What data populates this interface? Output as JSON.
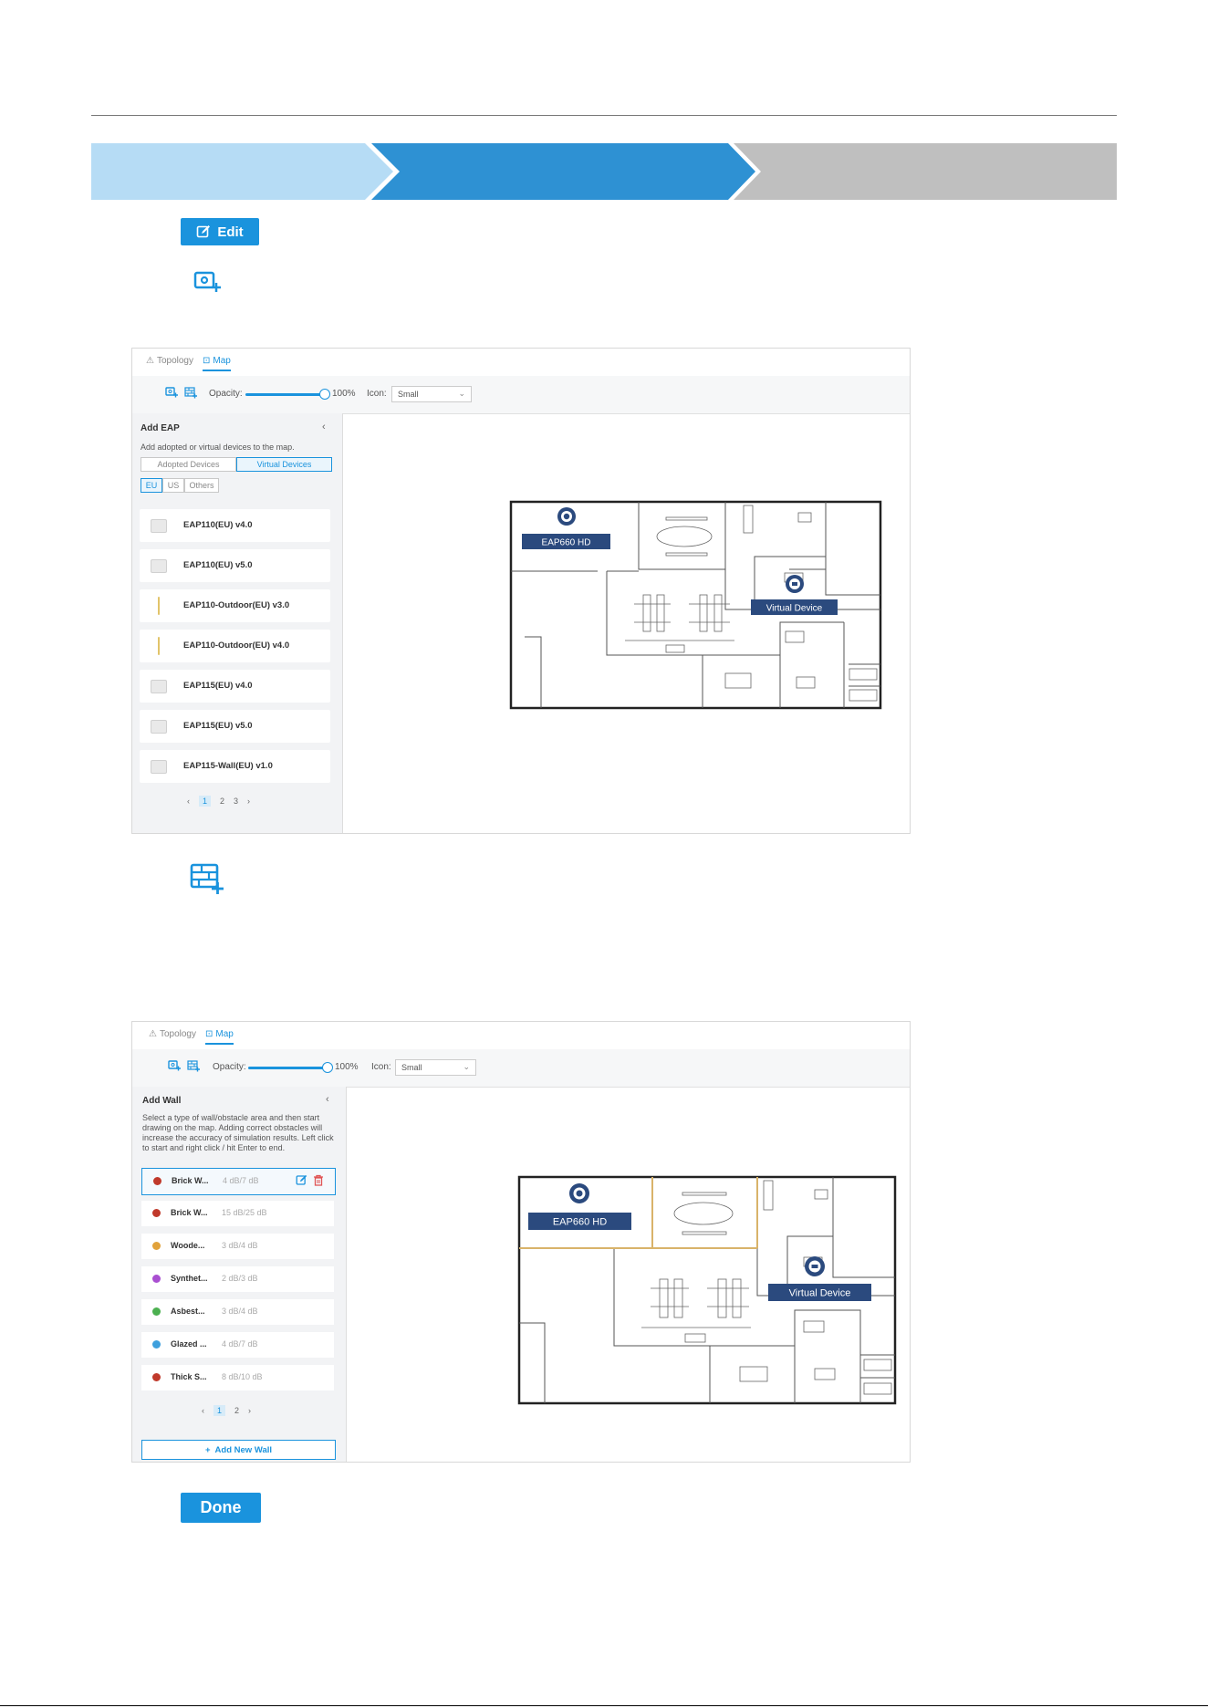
{
  "colors": {
    "accent": "#1a93dd",
    "step_done": "#b6dcf5",
    "step_active": "#2e91d3",
    "step_todo": "#bfbfbf",
    "map_label": "#2b4a7e"
  },
  "buttons": {
    "edit_label": "Edit",
    "done_label": "Done"
  },
  "icons": {
    "add_device": "add-device-icon",
    "add_wall": "add-wall-icon",
    "edit": "edit-icon"
  },
  "screenshot1": {
    "tabs": [
      {
        "label": "Topology"
      },
      {
        "label": "Map"
      }
    ],
    "toolbar": {
      "opacity_label": "Opacity:",
      "opacity_value": "100%",
      "icon_label": "Icon:",
      "icon_value": "Small",
      "opacity_level": 1.0
    },
    "panel": {
      "title": "Add EAP",
      "close": "‹",
      "desc": "Add adopted or virtual devices to the map.",
      "segments": [
        "Adopted Devices",
        "Virtual Devices"
      ],
      "regions": [
        "EU",
        "US",
        "Others"
      ],
      "devices": [
        {
          "label": "EAP110(EU) v4.0",
          "thumb": "box"
        },
        {
          "label": "EAP110(EU) v5.0",
          "thumb": "box"
        },
        {
          "label": "EAP110-Outdoor(EU) v3.0",
          "thumb": "pole"
        },
        {
          "label": "EAP110-Outdoor(EU) v4.0",
          "thumb": "pole"
        },
        {
          "label": "EAP115(EU) v4.0",
          "thumb": "box"
        },
        {
          "label": "EAP115(EU) v5.0",
          "thumb": "box"
        },
        {
          "label": "EAP115-Wall(EU) v1.0",
          "thumb": "box"
        }
      ],
      "pager": {
        "prev": "‹",
        "pages": [
          "1",
          "2",
          "3"
        ],
        "next": "›"
      }
    },
    "map": {
      "labels": [
        "EAP660 HD",
        "Virtual Device"
      ]
    }
  },
  "screenshot2": {
    "tabs": [
      {
        "label": "Topology"
      },
      {
        "label": "Map"
      }
    ],
    "toolbar": {
      "opacity_label": "Opacity:",
      "opacity_value": "100%",
      "icon_label": "Icon:",
      "icon_value": "Small",
      "opacity_level": 1.0
    },
    "panel": {
      "title": "Add Wall",
      "close": "‹",
      "desc_lines": [
        "Select a type of wall/obstacle area and then start",
        "drawing on the map. Adding correct obstacles will",
        "increase the accuracy of simulation results. Left click",
        "to start and right click / hit Enter to end."
      ],
      "walls": [
        {
          "name": "Brick W...",
          "db": "4 dB/7 dB",
          "color": "#c0392b",
          "selected": true
        },
        {
          "name": "Brick W...",
          "db": "15 dB/25 dB",
          "color": "#c0392b"
        },
        {
          "name": "Woode...",
          "db": "3 dB/4 dB",
          "color": "#e1a23b"
        },
        {
          "name": "Synthet...",
          "db": "2 dB/3 dB",
          "color": "#a94fd1"
        },
        {
          "name": "Asbest...",
          "db": "3 dB/4 dB",
          "color": "#4cb050"
        },
        {
          "name": "Glazed ...",
          "db": "4 dB/7 dB",
          "color": "#3ea0dd"
        },
        {
          "name": "Thick S...",
          "db": "8 dB/10 dB",
          "color": "#c0392b"
        }
      ],
      "pager": {
        "prev": "‹",
        "pages": [
          "1",
          "2"
        ],
        "next": "›"
      },
      "add_new_wall": "Add New Wall"
    },
    "map": {
      "labels": [
        "EAP660 HD",
        "Virtual Device"
      ]
    }
  }
}
